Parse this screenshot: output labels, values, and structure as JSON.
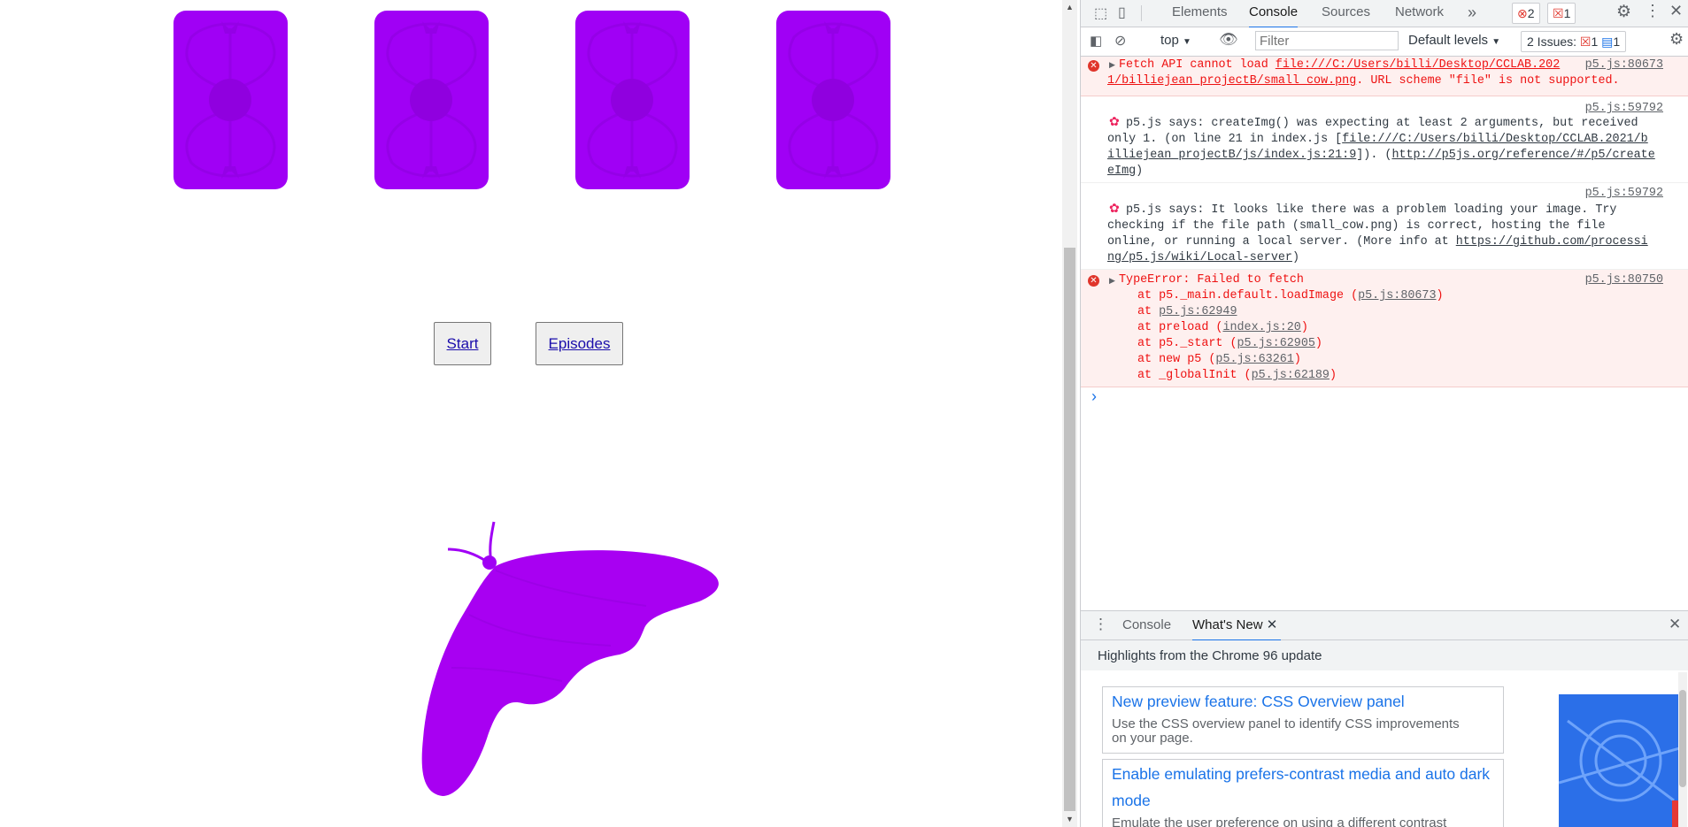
{
  "page": {
    "buttons": {
      "start": "Start",
      "episodes": "Episodes"
    }
  },
  "devtools": {
    "tabs": [
      "Elements",
      "Console",
      "Sources",
      "Network"
    ],
    "more_tabs": "»",
    "error_count": "2",
    "warning_count": "1",
    "toolbar": {
      "context": "top",
      "filter_placeholder": "Filter",
      "levels": "Default levels",
      "issues_label": "2 Issues:",
      "issues_err": "1",
      "issues_info": "1"
    },
    "messages": [
      {
        "lines": [
          "Fetch API cannot load ",
          "file:///C:/Users/billi/Desktop/CCLAB.202",
          "1/billiejean_projectB/small_cow.png",
          ". URL scheme \"file\" is not supported."
        ],
        "source": "p5.js:80673"
      },
      {
        "source": "p5.js:59792",
        "lines": [
          "p5.js says: createImg() was expecting at least 2 arguments, but received",
          "only 1. (on line 21 in index.js [",
          "file:///C:/Users/billi/Desktop/CCLAB.2021/b",
          "illiejean_projectB/js/index.js:21:9",
          "]). (",
          "http://p5js.org/reference/#/p5/create",
          "eImg",
          ")"
        ]
      },
      {
        "source": "p5.js:59792",
        "lines": [
          "p5.js says: It looks like there was a problem loading your image. Try",
          "checking if the file path (small_cow.png) is correct, hosting the file",
          "online, or running a local server. (More info at ",
          "https://github.com/processi",
          "ng/p5.js/wiki/Local-server",
          ")"
        ]
      },
      {
        "source": "p5.js:80750",
        "title": "TypeError: Failed to fetch",
        "stack": [
          {
            "pre": "at p5._main.default.loadImage (",
            "link": "p5.js:80673",
            "post": ")"
          },
          {
            "pre": "at ",
            "link": "p5.js:62949",
            "post": ""
          },
          {
            "pre": "at preload (",
            "link": "index.js:20",
            "post": ")"
          },
          {
            "pre": "at p5._start (",
            "link": "p5.js:62905",
            "post": ")"
          },
          {
            "pre": "at new p5 (",
            "link": "p5.js:63261",
            "post": ")"
          },
          {
            "pre": "at _globalInit (",
            "link": "p5.js:62189",
            "post": ")"
          }
        ]
      }
    ],
    "prompt": "›",
    "drawer": {
      "tabs": [
        "Console",
        "What's New"
      ],
      "heading": "Highlights from the Chrome 96 update",
      "cards": [
        {
          "title": "New preview feature: CSS Overview panel",
          "desc1": "Use the CSS overview panel to identify CSS improvements",
          "desc2": "on your page."
        },
        {
          "title": "Enable emulating prefers-contrast media and auto dark",
          "title2": "mode",
          "desc1": "Emulate the user preference on using a different contrast"
        }
      ]
    }
  },
  "colors": {
    "purple": "#a000f5",
    "error_red": "#e0352b",
    "link_blue": "#1a73e8"
  }
}
